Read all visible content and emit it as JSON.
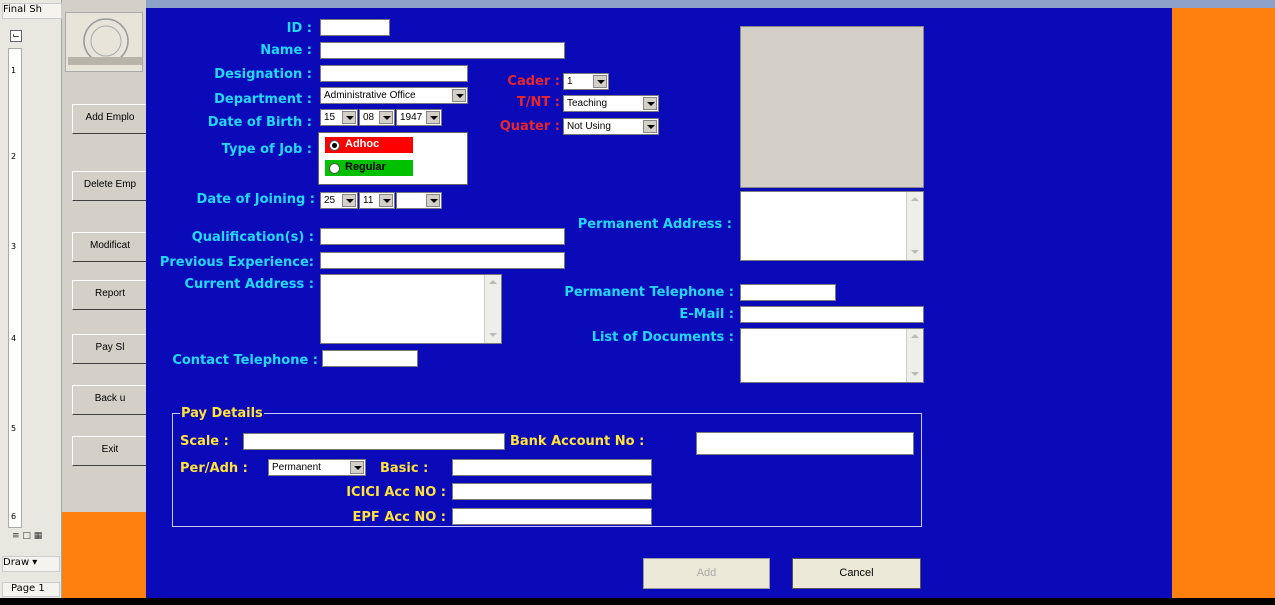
{
  "word": {
    "toolbar_label": "Final Sh",
    "draw_label": "Draw ▾",
    "page_label": "Page 1",
    "ruler_numbers": [
      "1",
      "2",
      "3",
      "4",
      "5",
      "6"
    ]
  },
  "switchboard": {
    "buttons": [
      "Add Emplo",
      "Delete Emp",
      "Modificat",
      "Report",
      "Pay Sl",
      "Back u",
      "Exit"
    ]
  },
  "form": {
    "labels": {
      "id": "ID :",
      "name": "Name :",
      "designation": "Designation :",
      "department": "Department :",
      "dob": "Date of Birth :",
      "job_type": "Type of Job :",
      "doj": "Date of Joining :",
      "qualification": "Qualification(s) :",
      "experience": "Previous Experience:",
      "current_address": "Current Address :",
      "contact_tel": "Contact Telephone :",
      "cader": "Cader :",
      "tnt": "T/NT :",
      "quater": "Quater :",
      "perm_address": "Permanent Address :",
      "perm_tel": "Permanent Telephone :",
      "email": "E-Mail :",
      "documents": "List of Documents :"
    },
    "values": {
      "department": "Administrative Office",
      "dob_day": "15",
      "dob_month": "08",
      "dob_year": "1947",
      "doj_day": "25",
      "doj_month": "11",
      "doj_year": "",
      "cader": "1",
      "tnt": "Teaching",
      "quater": "Not Using"
    },
    "job_options": {
      "adhoc": "Adhoc",
      "regular": "Regular",
      "selected": "Adhoc"
    },
    "pay": {
      "title": "Pay Details",
      "scale": "Scale :",
      "bank": "Bank Account No :",
      "per_adh": "Per/Adh :",
      "per_adh_value": "Permanent",
      "basic": "Basic :",
      "icici": "ICICI Acc NO :",
      "epf": "EPF Acc NO :"
    },
    "buttons": {
      "add": "Add",
      "cancel": "Cancel"
    }
  },
  "colors": {
    "form_bg": "#0a0ab8",
    "label_cyan": "#23d8ff",
    "label_red": "#e8242c",
    "label_yellow": "#ffe23a",
    "adhoc_bg": "#ff0000",
    "regular_bg": "#00c000",
    "accent_orange": "#ff7f0f"
  }
}
